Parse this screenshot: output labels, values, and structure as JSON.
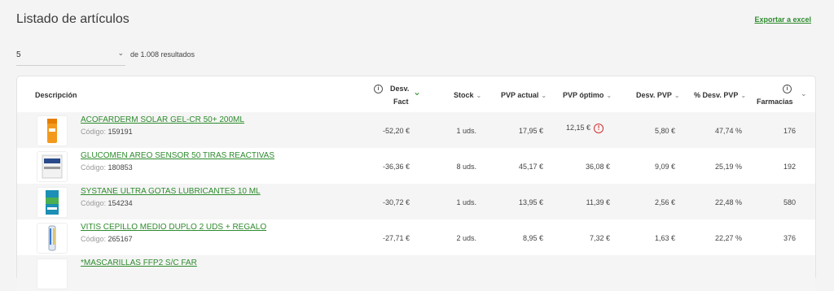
{
  "page": {
    "title": "Listado de artículos",
    "export_label": "Exportar a excel"
  },
  "pagination": {
    "page_size": "5",
    "results_text": "de 1.008 resultados"
  },
  "table": {
    "headers": {
      "descripcion": "Descripción",
      "desv_fact_1": "Desv.",
      "desv_fact_2": "Fact",
      "stock": "Stock",
      "pvp_actual": "PVP actual",
      "pvp_optimo": "PVP óptimo",
      "desv_pvp": "Desv. PVP",
      "pct_desv_pvp": "% Desv. PVP",
      "farmacias": "Farmacias"
    },
    "code_label": "Código:",
    "rows": [
      {
        "name": "ACOFARDERM SOLAR GEL-CR 50+ 200ML",
        "code": "159191",
        "desv_fact": "-52,20 €",
        "stock": "1 uds.",
        "pvp_actual": "17,95 €",
        "pvp_optimo": "12,15 €",
        "alert": true,
        "desv_pvp": "5,80 €",
        "pct_desv": "47,74 %",
        "farmacias": "176"
      },
      {
        "name": "GLUCOMEN AREO SENSOR 50 TIRAS REACTIVAS",
        "code": "180853",
        "desv_fact": "-36,36 €",
        "stock": "8 uds.",
        "pvp_actual": "45,17 €",
        "pvp_optimo": "36,08 €",
        "alert": false,
        "desv_pvp": "9,09 €",
        "pct_desv": "25,19 %",
        "farmacias": "192"
      },
      {
        "name": "SYSTANE ULTRA GOTAS LUBRICANTES 10 ML",
        "code": "154234",
        "desv_fact": "-30,72 €",
        "stock": "1 uds.",
        "pvp_actual": "13,95 €",
        "pvp_optimo": "11,39 €",
        "alert": false,
        "desv_pvp": "2,56 €",
        "pct_desv": "22,48 %",
        "farmacias": "580"
      },
      {
        "name": "VITIS CEPILLO MEDIO DUPLO 2 UDS + REGALO",
        "code": "265167",
        "desv_fact": "-27,71 €",
        "stock": "2 uds.",
        "pvp_actual": "8,95 €",
        "pvp_optimo": "7,32 €",
        "alert": false,
        "desv_pvp": "1,63 €",
        "pct_desv": "22,27 %",
        "farmacias": "376"
      },
      {
        "name": "*MASCARILLAS FFP2 S/C FAR"
      }
    ]
  },
  "colors": {
    "link": "#2e8b2e",
    "sort_active": "#2e8b2e",
    "alert": "#d32f2f"
  }
}
